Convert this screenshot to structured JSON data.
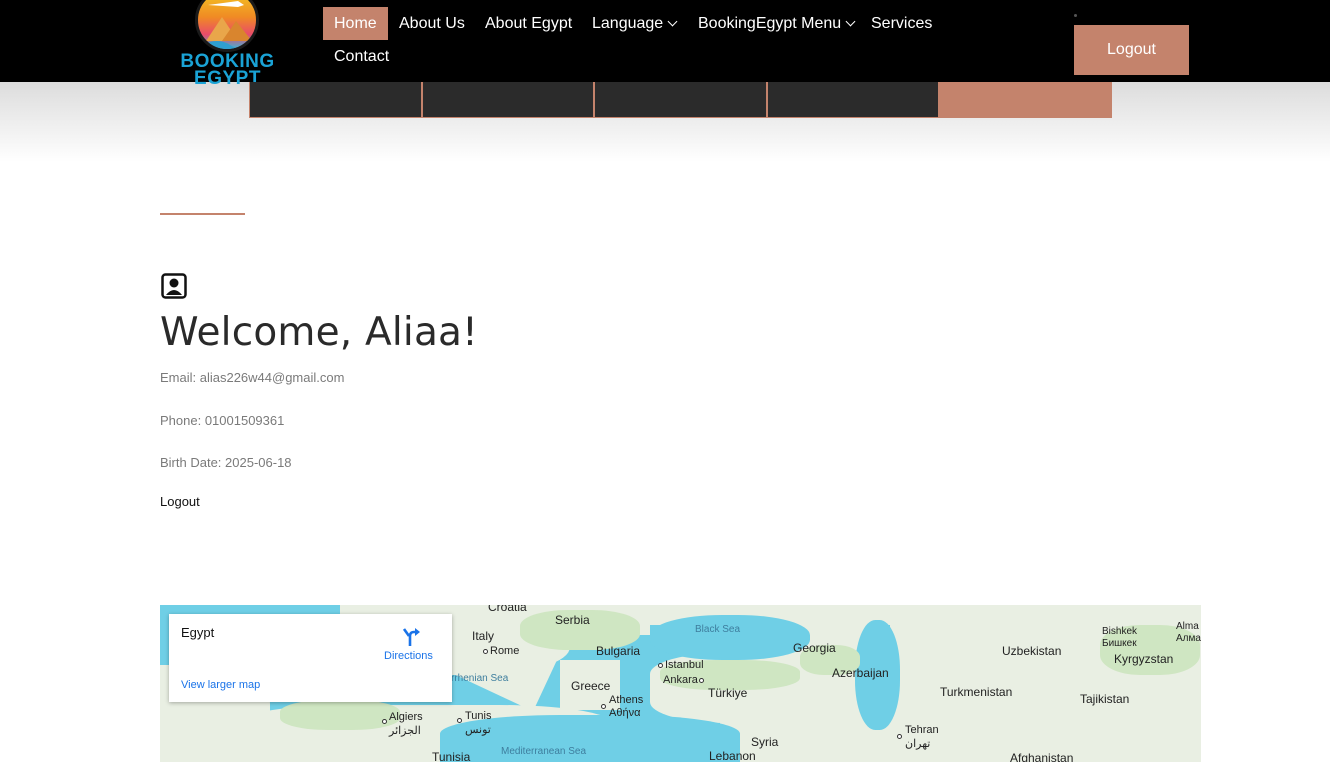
{
  "header": {
    "logo": {
      "line1": "BOOKING",
      "line2": "EGYPT"
    },
    "nav": [
      {
        "label": "Home",
        "active": true
      },
      {
        "label": "About Us"
      },
      {
        "label": "About Egypt"
      },
      {
        "label": "Language",
        "dropdown": true
      },
      {
        "label": "BookingEgypt Menu",
        "dropdown": true
      },
      {
        "label": "Services"
      },
      {
        "label": "Contact"
      }
    ],
    "logout_label": "Logout"
  },
  "profile": {
    "welcome": "Welcome, Aliaa!",
    "email": "Email: alias226w44@gmail.com",
    "phone": "Phone: 01001509361",
    "birth_date": "Birth Date: 2025-06-18",
    "logout_label": "Logout"
  },
  "map": {
    "card_title": "Egypt",
    "directions_label": "Directions",
    "view_larger_label": "View larger map",
    "labels": {
      "croatia": "Croatia",
      "serbia": "Serbia",
      "italy": "Italy",
      "rome": "Rome",
      "bulgaria": "Bulgaria",
      "black_sea": "Black Sea",
      "georgia": "Georgia",
      "uzbekistan": "Uzbekistan",
      "bishkek": "Bishkek",
      "bishkek_local": "Бишкек",
      "almaty": "Alma",
      "almaty_local": "Алма",
      "kyrgyzstan": "Kyrgyzstan",
      "istanbul": "Istanbul",
      "ankara": "Ankara",
      "azerbaijan": "Azerbaijan",
      "tyrrhenian": "rrhenian Sea",
      "greece": "Greece",
      "athens": "Athens",
      "athens_local": "Αθήνα",
      "turkiye": "Türkiye",
      "turkmenistan": "Turkmenistan",
      "tajikistan": "Tajikistan",
      "algiers": "Algiers",
      "algiers_local": "الجزائر",
      "tunis": "Tunis",
      "tunis_local": "تونس",
      "tehran": "Tehran",
      "tehran_local": "تهران",
      "syria": "Syria",
      "mediterranean": "Mediterranean Sea",
      "tunisia": "Tunisia",
      "lebanon": "Lebanon",
      "afghanistan": "Afghanistan"
    }
  },
  "colors": {
    "accent": "#c4836c",
    "header_bg": "#000000",
    "map_water": "#6fcfe6"
  }
}
